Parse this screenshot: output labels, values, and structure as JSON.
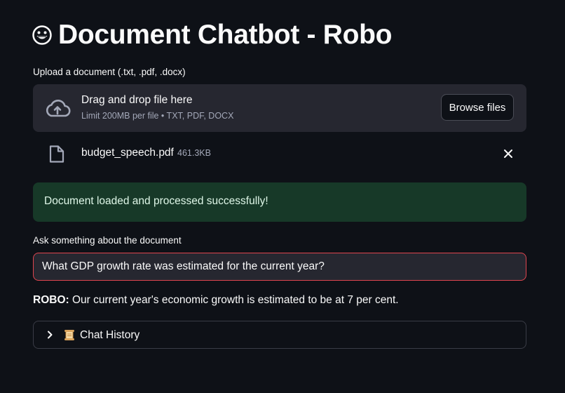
{
  "title": "Document Chatbot - Robo",
  "title_icon": "grinning-face-icon",
  "upload": {
    "label": "Upload a document (.txt, .pdf, .docx)",
    "drop_text": "Drag and drop file here",
    "limit_text": "Limit 200MB per file • TXT, PDF, DOCX",
    "browse_label": "Browse files",
    "file": {
      "name": "budget_speech.pdf",
      "size": "461.3KB"
    }
  },
  "status": {
    "message": "Document loaded and processed successfully!",
    "color": "#173928"
  },
  "question": {
    "label": "Ask something about the document",
    "value": "What GDP growth rate was estimated for the current year?"
  },
  "answer": {
    "speaker": "ROBO:",
    "text": " Our current year's economic growth is estimated to be at 7 per cent."
  },
  "history": {
    "icon": "scroll-icon",
    "label": "Chat History"
  },
  "colors": {
    "background": "#0e1117",
    "input_border": "#e0454f"
  }
}
